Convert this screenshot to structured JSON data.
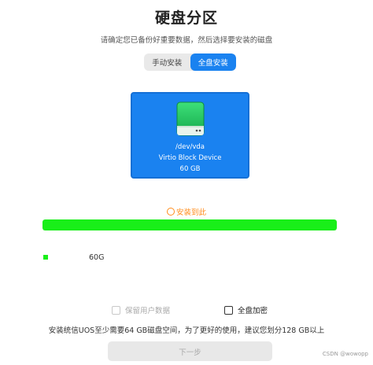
{
  "page": {
    "title": "硬盘分区",
    "subtitle": "请确定您已备份好重要数据，然后选择要安装的磁盘"
  },
  "mode_toggle": {
    "manual_label": "手动安装",
    "full_label": "全盘安装",
    "selected": "full"
  },
  "disk": {
    "icon": "hard-drive-icon",
    "path": "/dev/vda",
    "model": "Virtio Block Device",
    "size": "60 GB"
  },
  "install_target": {
    "status_label": "安装到此",
    "fill_percent": 100,
    "bar_color": "#19ef19",
    "legend_size": "60G"
  },
  "options": {
    "keep_user_data_label": "保留用户数据",
    "keep_user_data_enabled": false,
    "full_disk_encryption_label": "全盘加密"
  },
  "note": "安装统信UOS至少需要64 GB磁盘空间，为了更好的使用，建议您划分128 GB以上",
  "next_button_label": "下一步",
  "watermark": "CSDN @wowopp",
  "colors": {
    "accent": "#1a82f0",
    "status": "#ff8c1a",
    "partition": "#19ef19"
  }
}
